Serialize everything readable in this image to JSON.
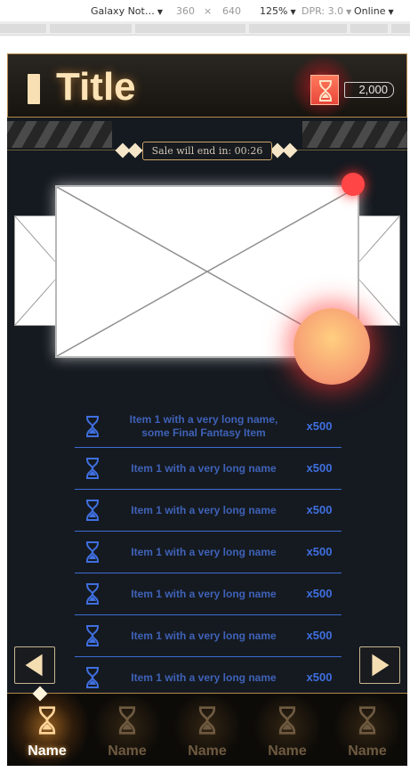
{
  "devtools": {
    "device": "Galaxy Not…",
    "width": "360",
    "times": "×",
    "height": "640",
    "zoom": "125%",
    "dpr": "DPR: 3.0",
    "network": "Online"
  },
  "header": {
    "title": "Title",
    "currency_icon": "hourglass-icon",
    "currency_amount": "2,000"
  },
  "sale": {
    "timer_text": "Sale will end in: 00:26"
  },
  "items": [
    {
      "name": "Item 1 with a very long name, some Final Fantasy Item",
      "qty": "x500",
      "icon": "hourglass-icon"
    },
    {
      "name": "Item 1 with a very long name",
      "qty": "x500",
      "icon": "hourglass-icon"
    },
    {
      "name": "Item 1 with a very long name",
      "qty": "x500",
      "icon": "hourglass-icon"
    },
    {
      "name": "Item 1 with a very long name",
      "qty": "x500",
      "icon": "hourglass-icon"
    },
    {
      "name": "Item 1 with a very long name",
      "qty": "x500",
      "icon": "hourglass-icon"
    },
    {
      "name": "Item 1 with a very long name",
      "qty": "x500",
      "icon": "hourglass-icon"
    },
    {
      "name": "Item 1 with a very long name",
      "qty": "x500",
      "icon": "hourglass-icon"
    }
  ],
  "tabs": [
    {
      "label": "Name",
      "active": true
    },
    {
      "label": "Name",
      "active": false
    },
    {
      "label": "Name",
      "active": false
    },
    {
      "label": "Name",
      "active": false
    },
    {
      "label": "Name",
      "active": false
    }
  ],
  "colors": {
    "accent_gold": "#c9a46a",
    "title_text": "#fde3b5",
    "item_text": "#3f62b8",
    "item_divider": "#3d6bd1",
    "badge_red": "#ff4545"
  }
}
